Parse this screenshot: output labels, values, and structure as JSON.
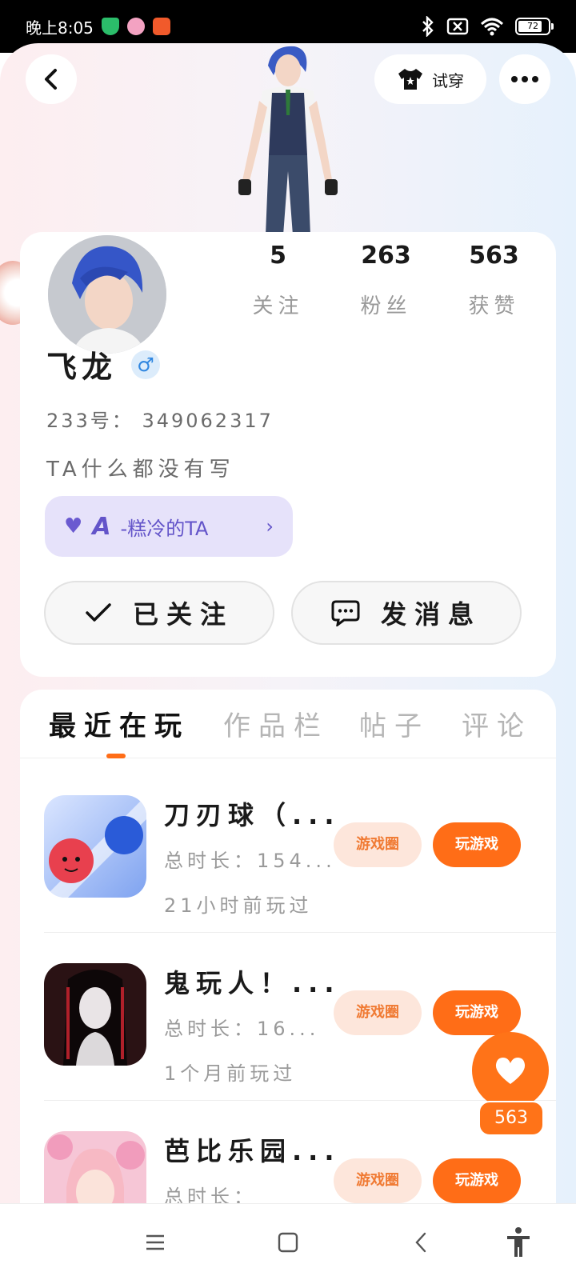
{
  "status_bar": {
    "time": "晚上8:05",
    "battery": "72"
  },
  "header": {
    "try_on_label": "试穿"
  },
  "profile": {
    "name": "飞龙",
    "gender_symbol": "♂",
    "uid_label": "233号：",
    "uid": "349062317",
    "bio": "TA什么都没有写",
    "tag_prefix": "A",
    "tag_text": "-糕冷的TA",
    "stats": [
      {
        "value": "5",
        "label": "关注"
      },
      {
        "value": "263",
        "label": "粉丝"
      },
      {
        "value": "563",
        "label": "获赞"
      }
    ],
    "followed_label": "已关注",
    "message_label": "发消息"
  },
  "tabs": [
    {
      "label": "最近在玩",
      "active": true
    },
    {
      "label": "作品栏",
      "active": false
    },
    {
      "label": "帖子",
      "active": false
    },
    {
      "label": "评论",
      "active": false
    }
  ],
  "games": [
    {
      "title": "刀刃球（...",
      "play_time": "总时长：154...",
      "last_played": "21小时前玩过",
      "circle_label": "游戏圈",
      "play_label": "玩游戏"
    },
    {
      "title": "鬼玩人！...",
      "play_time": "总时长：16...",
      "last_played": "1个月前玩过",
      "circle_label": "游戏圈",
      "play_label": "玩游戏"
    },
    {
      "title": "芭比乐园...",
      "play_time": "总时长：",
      "last_played": "",
      "circle_label": "游戏圈",
      "play_label": "玩游戏"
    }
  ],
  "like_fab": {
    "count": "563"
  },
  "colors": {
    "accent": "#ff6d17",
    "tag_bg": "#e6e2fa",
    "tag_text": "#6354c9",
    "gender_blue": "#2f86e0"
  }
}
